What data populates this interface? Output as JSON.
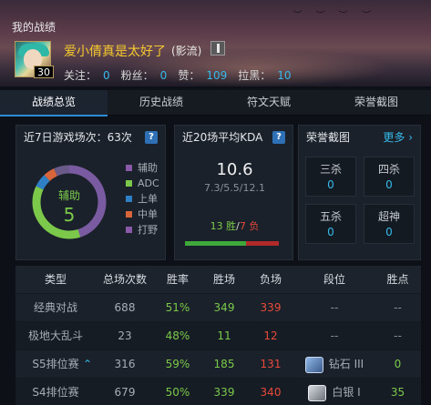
{
  "header": {
    "page_title": "我的战绩",
    "level": "30",
    "username": "爱小倩真是太好了",
    "user_tag": "(影流)",
    "stats": [
      {
        "label": "关注：",
        "value": "0"
      },
      {
        "label": "粉丝：",
        "value": "0"
      },
      {
        "label": "赞：",
        "value": "109"
      },
      {
        "label": "拉黑：",
        "value": "10"
      }
    ]
  },
  "tabs": [
    {
      "label": "战绩总览",
      "active": true
    },
    {
      "label": "历史战绩",
      "active": false
    },
    {
      "label": "符文天赋",
      "active": false
    },
    {
      "label": "荣誉截图",
      "active": false
    }
  ],
  "recent": {
    "title": "近7日游戏场次：63次",
    "help": "?",
    "center_label": "辅助",
    "center_value": "5",
    "roles": [
      {
        "label": "辅助",
        "color": "#8a5aa8"
      },
      {
        "label": "ADC",
        "color": "#7bc84a"
      },
      {
        "label": "上单",
        "color": "#2e7fc4"
      },
      {
        "label": "中单",
        "color": "#d8643a"
      },
      {
        "label": "打野",
        "color": "#8a5aa8"
      }
    ],
    "donut_segments": [
      {
        "role": "辅助",
        "fraction": 0.45,
        "color": "#7a5aa0"
      },
      {
        "role": "ADC",
        "fraction": 0.37,
        "color": "#7bc84a"
      },
      {
        "role": "上单",
        "fraction": 0.06,
        "color": "#2e7fc4"
      },
      {
        "role": "中单",
        "fraction": 0.05,
        "color": "#d8643a"
      },
      {
        "role": "打野",
        "fraction": 0.07,
        "color": "#6a5a8a"
      }
    ]
  },
  "kda": {
    "title": "近20场平均KDA",
    "help": "?",
    "value": "10.6",
    "detail": "7.3/5.5/12.1",
    "wins": "13 胜",
    "sep": "/",
    "losses": "7 负",
    "win_fraction": 0.65
  },
  "honor": {
    "title": "荣誉截图",
    "more": "更多",
    "cells": [
      {
        "name": "三杀",
        "count": "0"
      },
      {
        "name": "四杀",
        "count": "0"
      },
      {
        "name": "五杀",
        "count": "0"
      },
      {
        "name": "超神",
        "count": "0"
      }
    ]
  },
  "table": {
    "headers": [
      "类型",
      "总场次数",
      "胜率",
      "胜场",
      "负场",
      "段位",
      "胜点"
    ],
    "rows": [
      {
        "type": "经典对战",
        "total": "688",
        "rate": "51%",
        "win": "349",
        "loss": "339",
        "tier": "--",
        "pts": "--"
      },
      {
        "type": "极地大乱斗",
        "total": "23",
        "rate": "48%",
        "win": "11",
        "loss": "12",
        "tier": "--",
        "pts": "--"
      },
      {
        "type": "S5排位赛",
        "total": "316",
        "rate": "59%",
        "win": "185",
        "loss": "131",
        "tier": "钻石 III",
        "pts": "0"
      },
      {
        "type": "S4排位赛",
        "total": "679",
        "rate": "50%",
        "win": "339",
        "loss": "340",
        "tier": "白银 I",
        "pts": "35"
      }
    ]
  }
}
